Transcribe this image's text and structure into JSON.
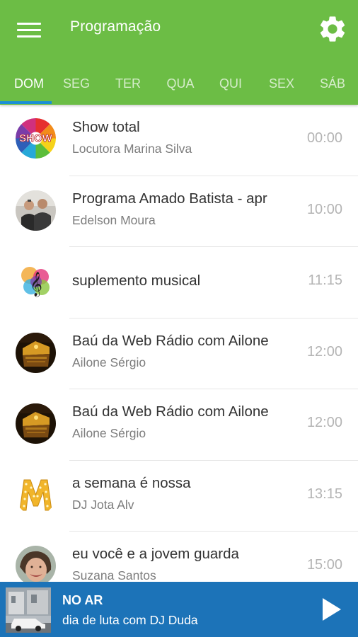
{
  "header": {
    "title": "Programação",
    "menu_icon": "hamburger-menu-icon",
    "settings_icon": "gear-icon",
    "bar_color": "#6cbd45"
  },
  "tabs": [
    {
      "label": "DOM",
      "active": true
    },
    {
      "label": "SEG",
      "active": false
    },
    {
      "label": "TER",
      "active": false
    },
    {
      "label": "QUA",
      "active": false
    },
    {
      "label": "QUI",
      "active": false
    },
    {
      "label": "SEX",
      "active": false
    },
    {
      "label": "SÁB",
      "active": false
    }
  ],
  "indicator_color": "#1a8fd6",
  "programs": [
    {
      "title": "Show total",
      "host": "Locutora Marina Silva",
      "time": "00:00",
      "avatar": "show-logo"
    },
    {
      "title": "Programa Amado Batista - apr",
      "host": "Edelson Moura",
      "time": "10:00",
      "avatar": "two-men-photo"
    },
    {
      "title": "suplemento musical",
      "host": "",
      "time": "11:15",
      "avatar": "rainbow-treble-clef"
    },
    {
      "title": "Baú da Web Rádio com Ailone",
      "host": "Ailone Sérgio",
      "time": "12:00",
      "avatar": "golden-chest-photo"
    },
    {
      "title": "Baú da Web Rádio com Ailone",
      "host": "Ailone Sérgio",
      "time": "12:00",
      "avatar": "golden-chest-photo"
    },
    {
      "title": "a semana é nossa",
      "host": "DJ Jota Alv",
      "time": "13:15",
      "avatar": "marquee-letter-m"
    },
    {
      "title": "eu você e a jovem guarda",
      "host": "Suzana Santos",
      "time": "15:00",
      "avatar": "woman-photo"
    }
  ],
  "player": {
    "label": "NO AR",
    "show": "dia de luta com DJ Duda",
    "thumbnail": "street-car-photo",
    "play_icon": "play-icon",
    "bar_color": "#1c73b8"
  }
}
